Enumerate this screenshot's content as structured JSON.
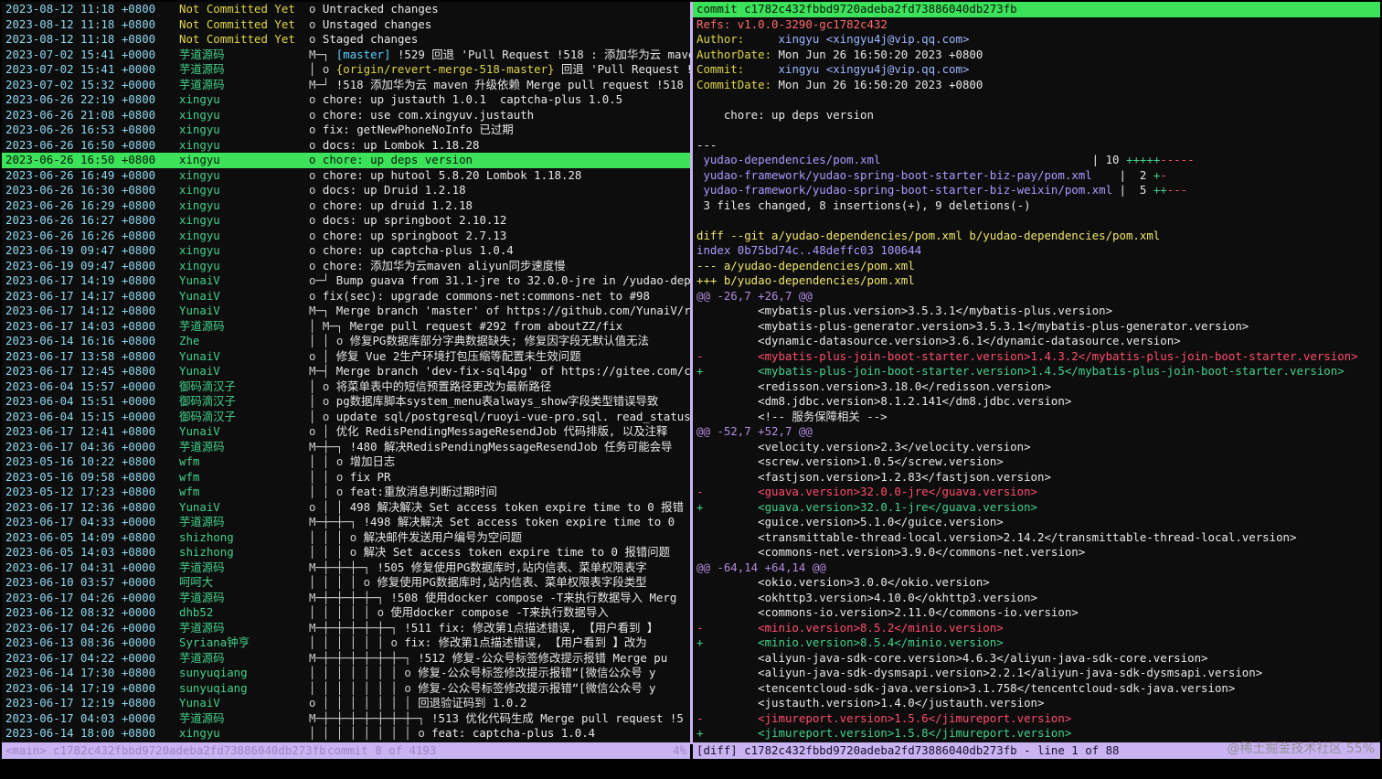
{
  "log": {
    "rows": [
      {
        "date": "2023-08-12 11:18 +0800",
        "author": "Not Committed Yet",
        "graph": "o",
        "message": "Untracked changes",
        "nc": true
      },
      {
        "date": "2023-08-12 11:18 +0800",
        "author": "Not Committed Yet",
        "graph": "o",
        "message": "Unstaged changes",
        "nc": true
      },
      {
        "date": "2023-08-12 11:18 +0800",
        "author": "Not Committed Yet",
        "graph": "o",
        "message": "Staged changes",
        "nc": true
      },
      {
        "date": "2023-07-02 15:41 +0000",
        "author": "芋道源码",
        "graph": "M─┐",
        "refs": "[master]",
        "message": "!529 回退 'Pull Request !518 : 添加华为云 maven"
      },
      {
        "date": "2023-07-02 15:41 +0000",
        "author": "芋道源码",
        "graph": "│ o",
        "revref": "{origin/revert-merge-518-master}",
        "message": "回退 'Pull Request !518"
      },
      {
        "date": "2023-07-02 15:32 +0000",
        "author": "芋道源码",
        "graph": "M─┘",
        "message": "!518 添加华为云 maven 升级依赖 Merge pull request !518"
      },
      {
        "date": "2023-06-26 22:19 +0800",
        "author": "xingyu",
        "graph": "o",
        "message": "chore: up justauth 1.0.1  captcha-plus 1.0.5"
      },
      {
        "date": "2023-06-26 21:08 +0800",
        "author": "xingyu",
        "graph": "o",
        "message": "chore: use com.xingyuv.justauth"
      },
      {
        "date": "2023-06-26 16:53 +0800",
        "author": "xingyu",
        "graph": "o",
        "message": "fix: getNewPhoneNoInfo 已过期"
      },
      {
        "date": "2023-06-26 16:50 +0800",
        "author": "xingyu",
        "graph": "o",
        "message": "docs: up Lombok 1.18.28"
      },
      {
        "date": "2023-06-26 16:50 +0800",
        "author": "xingyu",
        "graph": "o",
        "message": "chore: up deps version",
        "selected": true
      },
      {
        "date": "2023-06-26 16:49 +0800",
        "author": "xingyu",
        "graph": "o",
        "message": "chore: up hutool 5.8.20 Lombok 1.18.28"
      },
      {
        "date": "2023-06-26 16:30 +0800",
        "author": "xingyu",
        "graph": "o",
        "message": "docs: up Druid 1.2.18"
      },
      {
        "date": "2023-06-26 16:29 +0800",
        "author": "xingyu",
        "graph": "o",
        "message": "chore: up druid 1.2.18"
      },
      {
        "date": "2023-06-26 16:27 +0800",
        "author": "xingyu",
        "graph": "o",
        "message": "docs: up springboot 2.10.12"
      },
      {
        "date": "2023-06-26 16:26 +0800",
        "author": "xingyu",
        "graph": "o",
        "message": "chore: up springboot 2.7.13"
      },
      {
        "date": "2023-06-19 09:47 +0800",
        "author": "xingyu",
        "graph": "o",
        "message": "chore: up captcha-plus 1.0.4"
      },
      {
        "date": "2023-06-19 09:47 +0800",
        "author": "xingyu",
        "graph": "o",
        "message": "chore: 添加华为云maven aliyun同步速度慢"
      },
      {
        "date": "2023-06-17 14:19 +0800",
        "author": "YunaiV",
        "graph": "o─┘",
        "message": "Bump guava from 31.1-jre to 32.0.0-jre in /yudao-depend"
      },
      {
        "date": "2023-06-17 14:17 +0800",
        "author": "YunaiV",
        "graph": "o",
        "message": "fix(sec): upgrade commons-net:commons-net to #98"
      },
      {
        "date": "2023-06-17 14:12 +0800",
        "author": "YunaiV",
        "graph": "M─┐",
        "message": "Merge branch 'master' of https://github.com/YunaiV/ruoy"
      },
      {
        "date": "2023-06-17 14:03 +0800",
        "author": "芋道源码",
        "graph": "│ M─┐",
        "message": "Merge pull request #292 from aboutZZ/fix"
      },
      {
        "date": "2023-06-14 16:16 +0800",
        "author": "Zhe",
        "graph": "│ │ o",
        "message": "修复PG数据库部分字典数据缺失; 修复因字段无默认值无法"
      },
      {
        "date": "2023-06-17 13:58 +0800",
        "author": "YunaiV",
        "graph": "o │",
        "message": "修复 Vue 2生产环境打包压缩等配置未生效问题"
      },
      {
        "date": "2023-06-17 12:45 +0800",
        "author": "YunaiV",
        "graph": "M─┤",
        "message": "Merge branch 'dev-fix-sql4pg' of https://gitee.com/co"
      },
      {
        "date": "2023-06-04 15:57 +0000",
        "author": "御码滴汉子",
        "graph": "│ o",
        "message": "将菜单表中的短信预置路径更改为最新路径"
      },
      {
        "date": "2023-06-04 15:51 +0000",
        "author": "御码滴汉子",
        "graph": "│ o",
        "message": "pg数据库脚本system_menu表always_show字段类型错误导致"
      },
      {
        "date": "2023-06-04 15:15 +0000",
        "author": "御码滴汉子",
        "graph": "│ o",
        "message": "update sql/postgresql/ruoyi-vue-pro.sql. read_status"
      },
      {
        "date": "2023-06-17 12:41 +0800",
        "author": "YunaiV",
        "graph": "o │",
        "message": "优化 RedisPendingMessageResendJob 代码排版, 以及注释"
      },
      {
        "date": "2023-06-17 04:36 +0000",
        "author": "芋道源码",
        "graph": "M─┼─┐",
        "message": "!480 解决RedisPendingMessageResendJob 任务可能会导"
      },
      {
        "date": "2023-05-16 10:22 +0800",
        "author": "wfm",
        "graph": "│ │ o",
        "message": "增加日志"
      },
      {
        "date": "2023-05-16 09:58 +0800",
        "author": "wfm",
        "graph": "│ │ o",
        "message": "fix PR"
      },
      {
        "date": "2023-05-12 17:23 +0800",
        "author": "wfm",
        "graph": "│ │ o",
        "message": "feat:重放消息判断过期时间"
      },
      {
        "date": "2023-06-17 12:36 +0800",
        "author": "YunaiV",
        "graph": "o │ │",
        "message": "498 解决解决 Set access token expire time to 0 报错"
      },
      {
        "date": "2023-06-17 04:33 +0000",
        "author": "芋道源码",
        "graph": "M─┼─┼─┐",
        "message": "!498 解决解决 Set access token expire time to 0"
      },
      {
        "date": "2023-06-05 14:09 +0800",
        "author": "shizhong",
        "graph": "│ │ │ o",
        "message": "解决邮件发送用户编号为空问题"
      },
      {
        "date": "2023-06-05 14:03 +0800",
        "author": "shizhong",
        "graph": "│ │ │ o",
        "message": "解决 Set access token expire time to 0 报错问题"
      },
      {
        "date": "2023-06-17 04:31 +0000",
        "author": "芋道源码",
        "graph": "M─┼─┼─┼─┐",
        "message": "!505 修复使用PG数据库时,站内信表、菜单权限表字"
      },
      {
        "date": "2023-06-10 03:57 +0000",
        "author": "呵呵大",
        "graph": "│ │ │ │ o",
        "message": "修复使用PG数据库时,站内信表、菜单权限表字段类型"
      },
      {
        "date": "2023-06-17 04:26 +0000",
        "author": "芋道源码",
        "graph": "M─┼─┼─┼─┼─┐",
        "message": "!508 使用docker compose -T来执行数据导入 Merg"
      },
      {
        "date": "2023-06-12 08:32 +0000",
        "author": "dhb52",
        "graph": "│ │ │ │ │ o",
        "message": "使用docker compose -T来执行数据导入"
      },
      {
        "date": "2023-06-17 04:26 +0000",
        "author": "芋道源码",
        "graph": "M─┼─┼─┼─┼─┼─┐",
        "message": "!511 fix: 修改第1点描述错误, 【用户看到 】"
      },
      {
        "date": "2023-06-13 08:36 +0000",
        "author": "Syriana钟亨",
        "graph": "│ │ │ │ │ │ o",
        "message": "fix: 修改第1点描述错误, 【用户看到 】改为"
      },
      {
        "date": "2023-06-17 04:22 +0000",
        "author": "芋道源码",
        "graph": "M─┼─┼─┼─┼─┼─┼─┐",
        "message": "!512 修复-公众号标签修改提示报错 Merge pu"
      },
      {
        "date": "2023-06-14 17:30 +0800",
        "author": "sunyuqiang",
        "graph": "│ │ │ │ │ │ │ o",
        "message": "修复-公众号标签修改提示报错“[微信公众号 y"
      },
      {
        "date": "2023-06-14 17:19 +0800",
        "author": "sunyuqiang",
        "graph": "│ │ │ │ │ │ │ o",
        "message": "修复-公众号标签修改提示报错“[微信公众号 y"
      },
      {
        "date": "2023-06-17 12:19 +0800",
        "author": "YunaiV",
        "graph": "o │ │ │ │ │ │ │",
        "message": "回退验证码到 1.0.2"
      },
      {
        "date": "2023-06-17 04:03 +0000",
        "author": "芋道源码",
        "graph": "M─┼─┼─┼─┼─┼─┼─┼─┐",
        "message": "!513 优化代码生成 Merge pull request !5"
      },
      {
        "date": "2023-06-14 18:00 +0800",
        "author": "xingyu",
        "graph": "│ │ │ │ │ │ │ │ o",
        "message": "feat: captcha-plus 1.0.4"
      }
    ],
    "status_left": "<main> c1782c432fbbd9720adeba2fd73886040db273fb",
    "status_center": "commit 8 of 4193",
    "status_right": "4%"
  },
  "diff": {
    "commit": "commit c1782c432fbbd9720adeba2fd73886040db273fb",
    "refs": "Refs: v1.0.0-3290-gc1782c432",
    "author_label": "Author:",
    "author_value": "xingyu <xingyu4j@vip.qq.com>",
    "author_date_label": "AuthorDate:",
    "author_date_value": "Mon Jun 26 16:50:20 2023 +0800",
    "committer_label": "Commit:",
    "committer_value": "xingyu <xingyu4j@vip.qq.com>",
    "commit_date_label": "CommitDate:",
    "commit_date_value": "Mon Jun 26 16:50:20 2023 +0800",
    "message": "    chore: up deps version",
    "separator": "---",
    "stats": [
      {
        "file": " yudao-dependencies/pom.xml                               ",
        "count": "| 10 ",
        "plus": "+++++",
        "minus": "-----"
      },
      {
        "file": " yudao-framework/yudao-spring-boot-starter-biz-pay/pom.xml    ",
        "count": "|  2 ",
        "plus": "+",
        "minus": "-"
      },
      {
        "file": " yudao-framework/yudao-spring-boot-starter-biz-weixin/pom.xml ",
        "count": "|  5 ",
        "plus": "++",
        "minus": "---"
      }
    ],
    "summary": " 3 files changed, 8 insertions(+), 9 deletions(-)",
    "lines": [
      {
        "t": "blank",
        "text": ""
      },
      {
        "t": "diff",
        "text": "diff --git a/yudao-dependencies/pom.xml b/yudao-dependencies/pom.xml"
      },
      {
        "t": "index",
        "text": "index 0b75bd74c..48deffc03 100644"
      },
      {
        "t": "diff",
        "text": "--- a/yudao-dependencies/pom.xml"
      },
      {
        "t": "diff",
        "text": "+++ b/yudao-dependencies/pom.xml"
      },
      {
        "t": "hunk",
        "text": "@@ -26,7 +26,7 @@"
      },
      {
        "t": "ctx",
        "text": "         <mybatis-plus.version>3.5.3.1</mybatis-plus.version>"
      },
      {
        "t": "ctx",
        "text": "         <mybatis-plus-generator.version>3.5.3.1</mybatis-plus-generator.version>"
      },
      {
        "t": "ctx",
        "text": "         <dynamic-datasource.version>3.6.1</dynamic-datasource.version>"
      },
      {
        "t": "del",
        "text": "-        <mybatis-plus-join-boot-starter.version>1.4.3.2</mybatis-plus-join-boot-starter.version>"
      },
      {
        "t": "add",
        "text": "+        <mybatis-plus-join-boot-starter.version>1.4.5</mybatis-plus-join-boot-starter.version>"
      },
      {
        "t": "ctx",
        "text": "         <redisson.version>3.18.0</redisson.version>"
      },
      {
        "t": "ctx",
        "text": "         <dm8.jdbc.version>8.1.2.141</dm8.jdbc.version>"
      },
      {
        "t": "ctx",
        "text": "         <!-- 服务保障相关 -->"
      },
      {
        "t": "hunk",
        "text": "@@ -52,7 +52,7 @@"
      },
      {
        "t": "ctx",
        "text": "         <velocity.version>2.3</velocity.version>"
      },
      {
        "t": "ctx",
        "text": "         <screw.version>1.0.5</screw.version>"
      },
      {
        "t": "ctx",
        "text": "         <fastjson.version>1.2.83</fastjson.version>"
      },
      {
        "t": "del",
        "text": "-        <guava.version>32.0.0-jre</guava.version>"
      },
      {
        "t": "add",
        "text": "+        <guava.version>32.0.1-jre</guava.version>"
      },
      {
        "t": "ctx",
        "text": "         <guice.version>5.1.0</guice.version>"
      },
      {
        "t": "ctx",
        "text": "         <transmittable-thread-local.version>2.14.2</transmittable-thread-local.version>"
      },
      {
        "t": "ctx",
        "text": "         <commons-net.version>3.9.0</commons-net.version>"
      },
      {
        "t": "hunk",
        "text": "@@ -64,14 +64,14 @@"
      },
      {
        "t": "ctx",
        "text": "         <okio.version>3.0.0</okio.version>"
      },
      {
        "t": "ctx",
        "text": "         <okhttp3.version>4.10.0</okhttp3.version>"
      },
      {
        "t": "ctx",
        "text": "         <commons-io.version>2.11.0</commons-io.version>"
      },
      {
        "t": "del",
        "text": "-        <minio.version>8.5.2</minio.version>"
      },
      {
        "t": "add",
        "text": "+        <minio.version>8.5.4</minio.version>"
      },
      {
        "t": "ctx",
        "text": "         <aliyun-java-sdk-core.version>4.6.3</aliyun-java-sdk-core.version>"
      },
      {
        "t": "ctx",
        "text": "         <aliyun-java-sdk-dysmsapi.version>2.2.1</aliyun-java-sdk-dysmsapi.version>"
      },
      {
        "t": "ctx",
        "text": "         <tencentcloud-sdk-java.version>3.1.758</tencentcloud-sdk-java.version>"
      },
      {
        "t": "ctx",
        "text": "         <justauth.version>1.4.0</justauth.version>"
      },
      {
        "t": "del",
        "text": "-        <jimureport.version>1.5.6</jimureport.version>"
      },
      {
        "t": "add",
        "text": "+        <jimureport.version>1.5.8</jimureport.version>"
      },
      {
        "t": "ctx",
        "text": "         <xercesImpl.version>2.12.2</xercesImpl.version>"
      }
    ],
    "status": "[diff] c1782c432fbbd9720adeba2fd73886040db273fb - line 1 of 88"
  },
  "watermark": "@稀土掘金技术社区",
  "watermark_suffix": "55%",
  "colors": {
    "selection": "#3be25a",
    "statusbar": "#c9b3f0",
    "date": "#8ed8f0",
    "author": "#43d18c",
    "added": "#43d18c",
    "removed": "#ff4d6d",
    "hunk": "#b38ae0"
  }
}
